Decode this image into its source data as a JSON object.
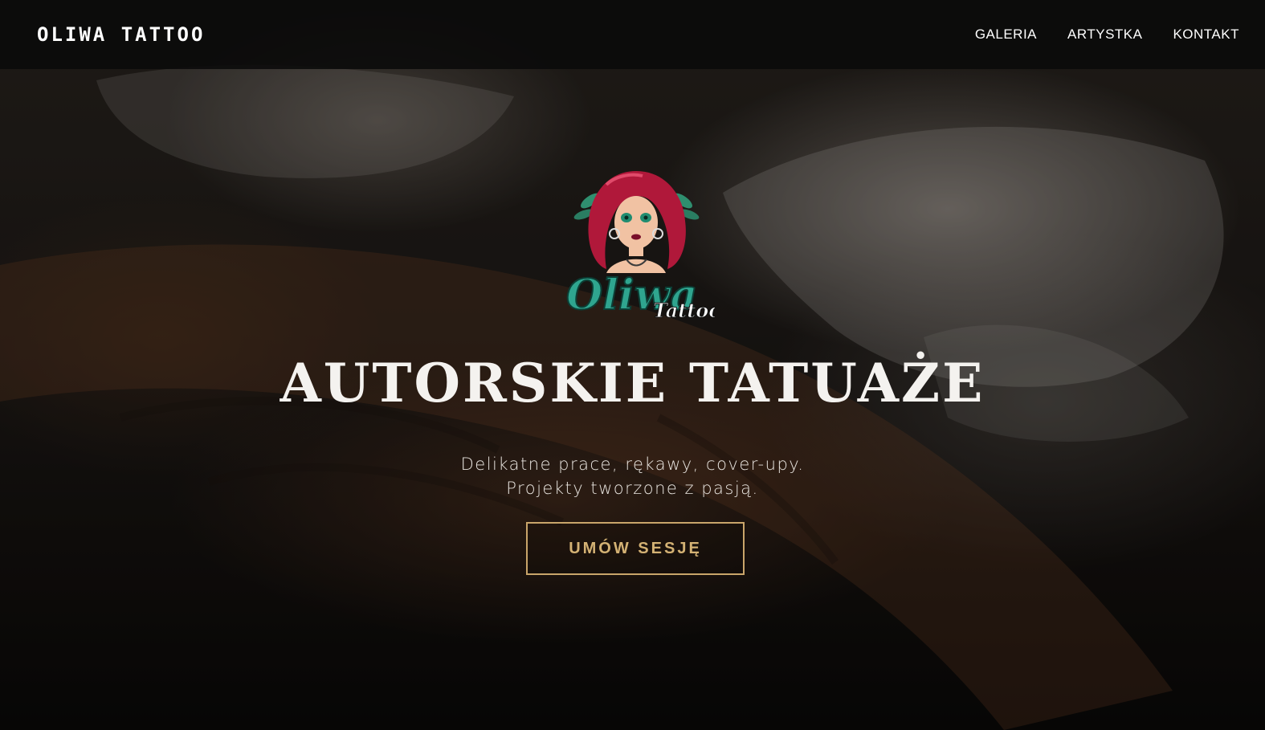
{
  "nav": {
    "brand": "OLIWA TATTOO",
    "links": [
      {
        "label": "GALERIA"
      },
      {
        "label": "ARTYSTKA"
      },
      {
        "label": "KONTAKT"
      }
    ]
  },
  "hero": {
    "logo": {
      "text_main": "Oliwa",
      "text_sub": "Tattoo",
      "icon": "tattoo-girl-logo-icon"
    },
    "headline": "AUTORSKIE TATUAŻE",
    "subtitle_line1": "Delikatne prace, rękawy, cover-upy.",
    "subtitle_line2": "Projekty tworzone z pasją.",
    "cta_label": "UMÓW SESJĘ"
  },
  "colors": {
    "accent_gold": "#c9a56a",
    "logo_teal": "#2fa58f",
    "logo_red": "#b0183a",
    "nav_background": "#0a0a0a"
  }
}
